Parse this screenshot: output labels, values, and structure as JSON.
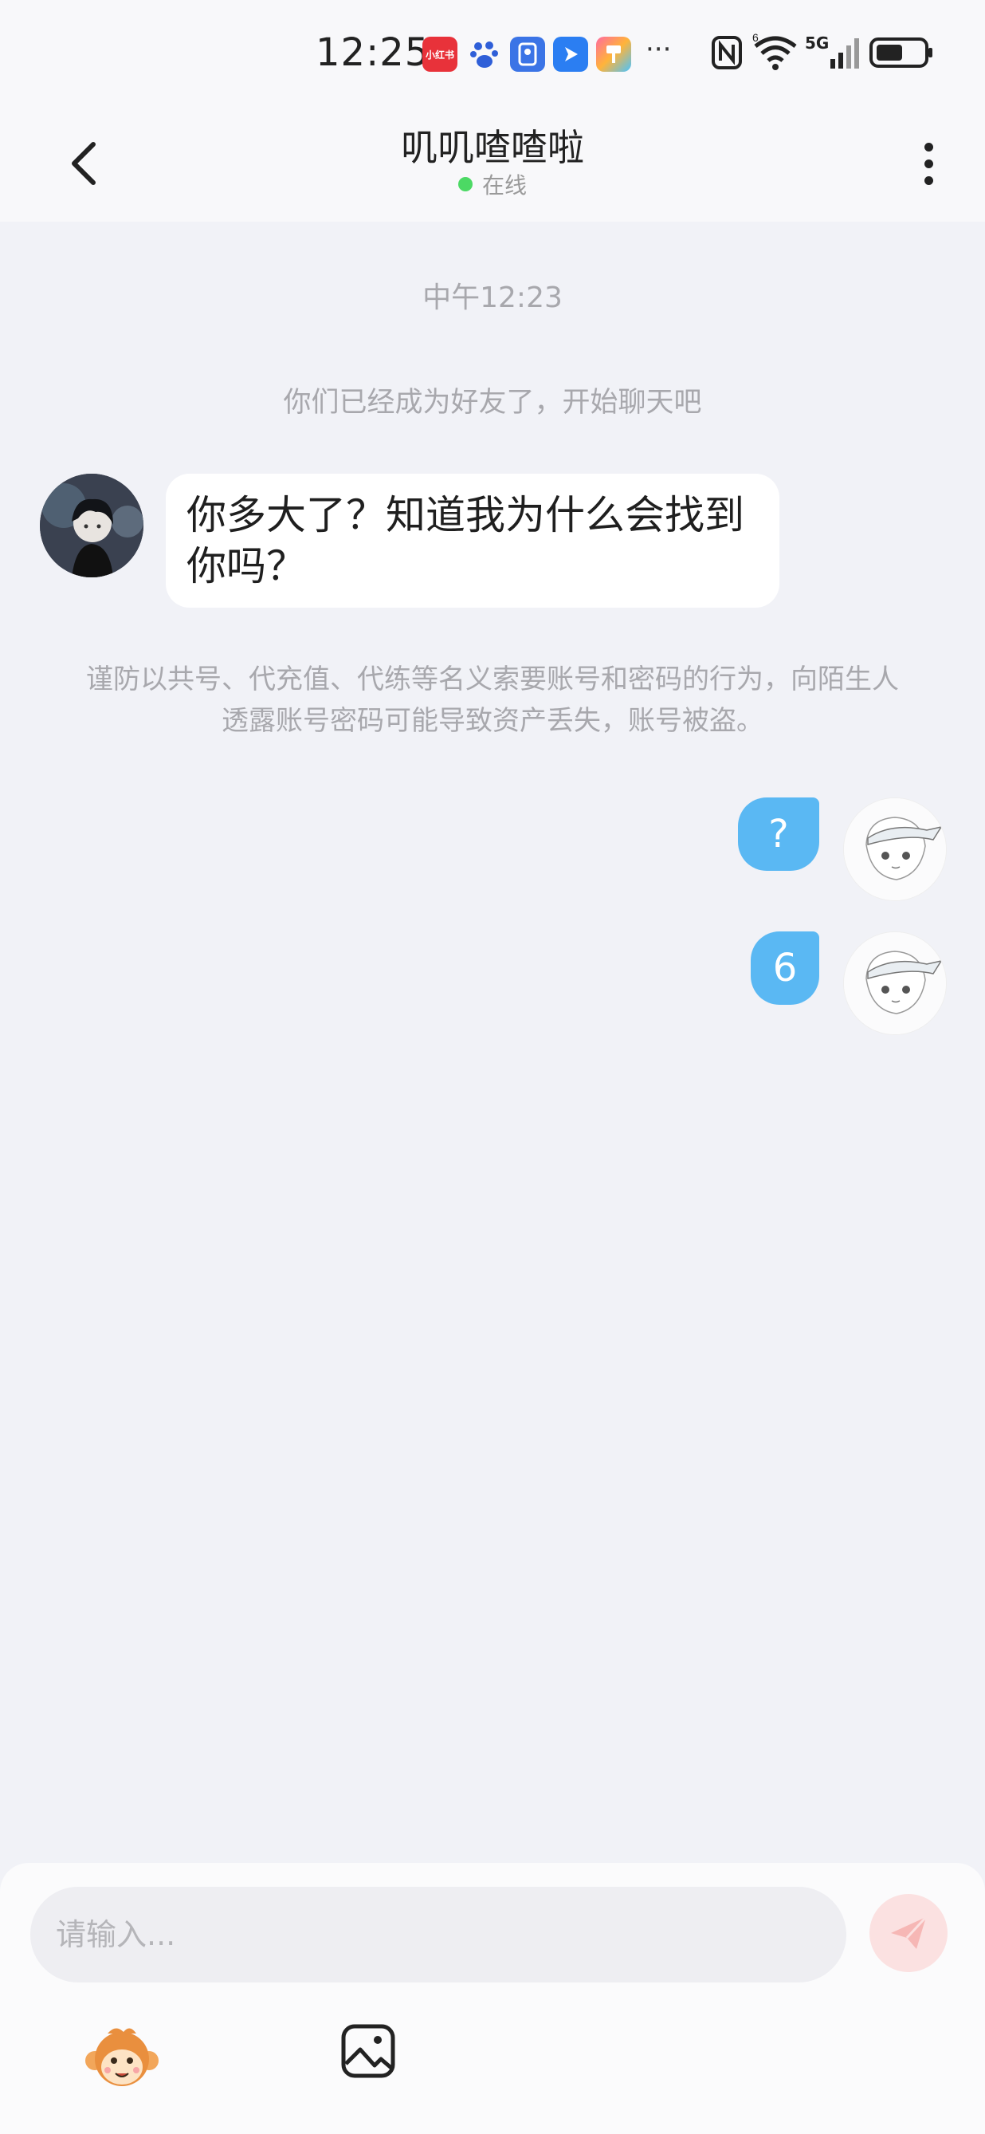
{
  "status_bar": {
    "time": "12:25",
    "app_icons": [
      "xiaohongshu-icon",
      "baidu-icon",
      "app-icon-blue",
      "app-icon-arrow",
      "app-icon-colorful"
    ],
    "xiaohongshu_label": "小红书",
    "more": "···",
    "nfc_icon": "nfc-icon",
    "wifi_icon": "wifi-icon",
    "signal_label": "5G",
    "battery_icon": "battery-icon"
  },
  "header": {
    "title": "叽叽喳喳啦",
    "status": "在线",
    "status_color": "#4cd964"
  },
  "chat": {
    "timestamp": "中午12:23",
    "system_note": "你们已经成为好友了，开始聊天吧",
    "incoming_message": "你多大了？知道我为什么会找到你吗？",
    "warning": "谨防以共号、代充值、代练等名义索要账号和密码的行为，向陌生人透露账号密码可能导致资产丢失，账号被盗。",
    "outgoing_messages": [
      "?",
      "6"
    ],
    "outgoing_bubble_color": "#5ab8f3"
  },
  "composer": {
    "placeholder": "请输入...",
    "send_icon": "send-icon",
    "emoji_icon": "monkey-emoji-icon",
    "image_icon": "image-icon"
  }
}
